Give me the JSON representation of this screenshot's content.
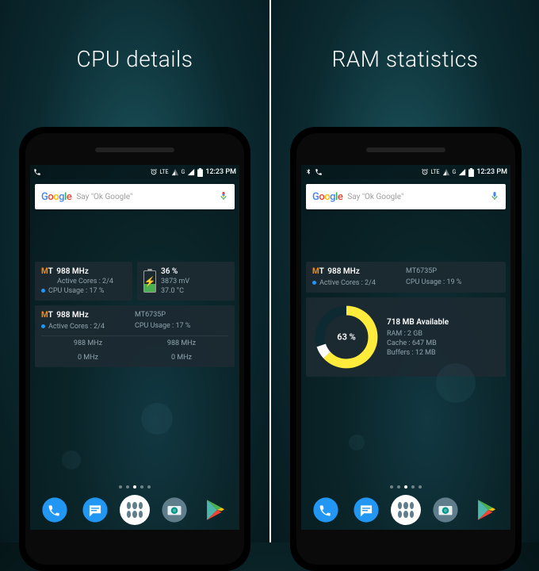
{
  "left": {
    "title": "CPU details",
    "statusbar": {
      "lte": "LTE",
      "g": "G",
      "time": "12:23 PM"
    },
    "search": {
      "logo": "Google",
      "placeholder": "Say \"Ok Google\""
    },
    "cpu_small": {
      "freq": "988 MHz",
      "cores": "Active Cores : 2/4",
      "usage": "CPU Usage : 17 %"
    },
    "battery": {
      "pct": "36 %",
      "mv": "3873 mV",
      "temp": "37.0 °C"
    },
    "cpu_big": {
      "freq": "988 MHz",
      "cores": "Active Cores : 2/4",
      "model": "MT6735P",
      "usage": "CPU Usage : 17 %",
      "c1": "988 MHz",
      "c2": "988 MHz",
      "c3": "0 MHz",
      "c4": "0 MHz"
    }
  },
  "right": {
    "title": "RAM statistics",
    "statusbar": {
      "lte": "LTE",
      "g": "G",
      "time": "12:23 PM"
    },
    "search": {
      "logo": "Google",
      "placeholder": "Say \"Ok Google\""
    },
    "cpu": {
      "freq": "988 MHz",
      "cores": "Active Cores : 2/4",
      "model": "MT6735P",
      "usage": "CPU Usage : 19 %"
    },
    "ram": {
      "pct": "63 %",
      "avail": "718 MB Available",
      "total": "RAM : 2 GB",
      "cache": "Cache : 647 MB",
      "buffers": "Buffers : 12 MB"
    }
  }
}
